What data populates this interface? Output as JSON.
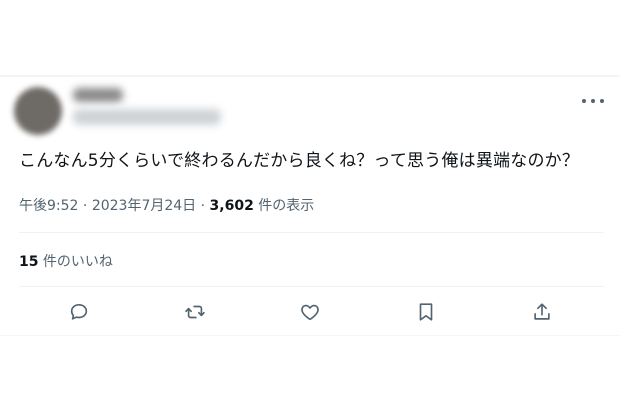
{
  "tweet": {
    "text": "こんなん5分くらいで終わるんだから良くね？って思う俺は異端なのか？",
    "time": "午後9:52",
    "separator": " · ",
    "date": "2023年7月24日",
    "views_count": "3,602",
    "views_label": " 件の表示",
    "likes_count": "15",
    "likes_label": " 件のいいね"
  },
  "icons": {
    "more": "more-horizontal-icon",
    "reply": "reply-icon",
    "retweet": "retweet-icon",
    "like": "heart-icon",
    "bookmark": "bookmark-icon",
    "share": "share-icon"
  },
  "colors": {
    "text": "#0f1419",
    "secondary": "#536471",
    "divider": "#eff3f4"
  }
}
